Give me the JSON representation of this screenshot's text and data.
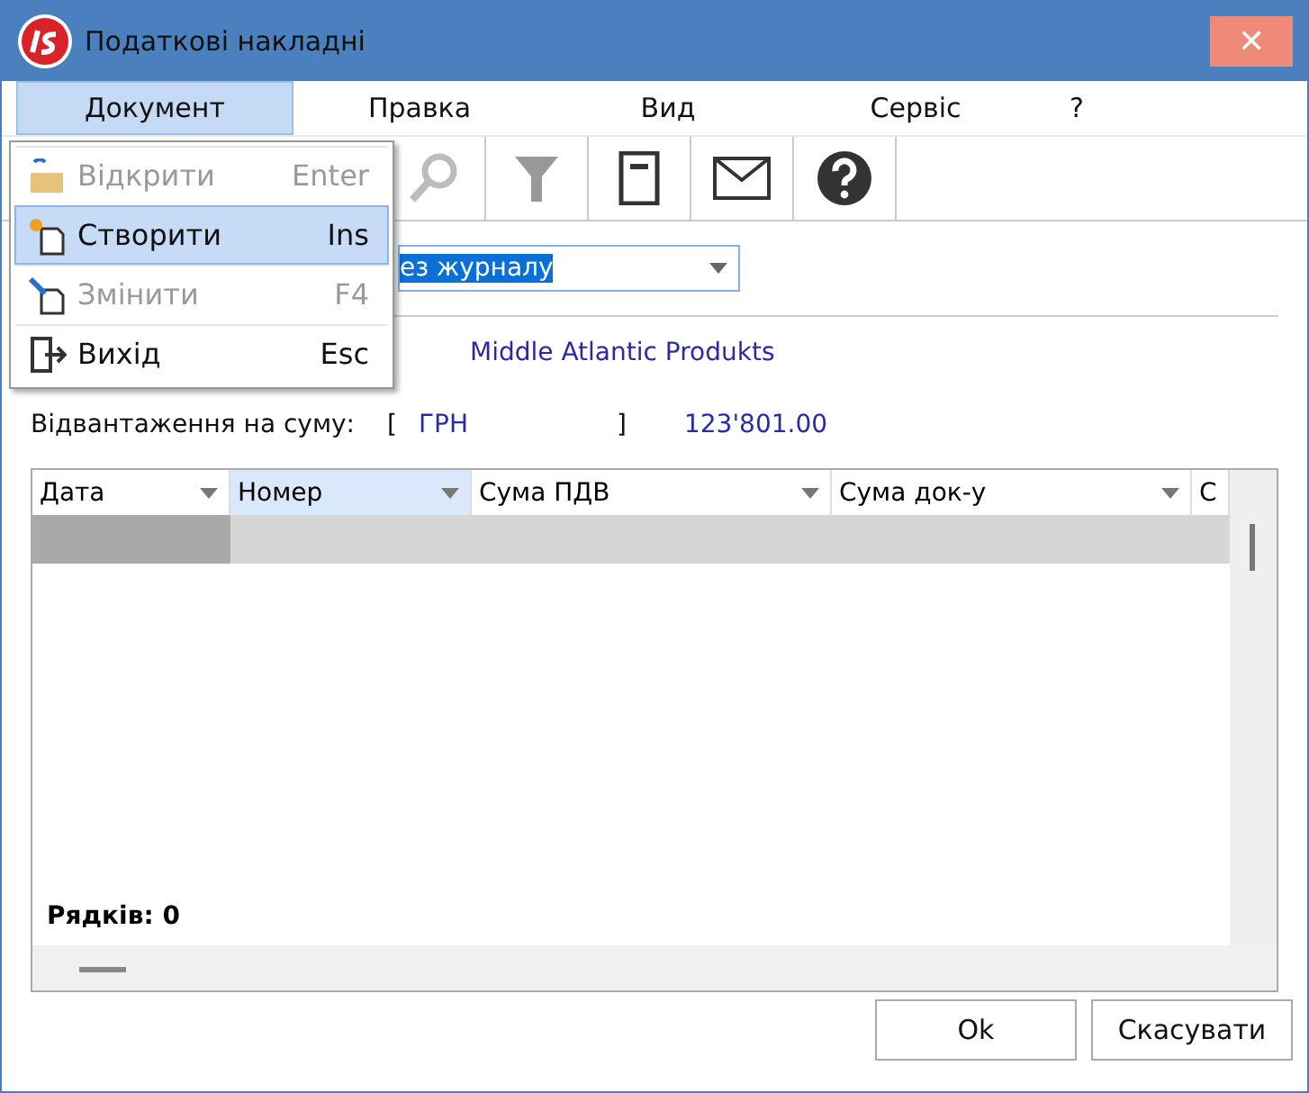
{
  "window": {
    "title": "Податкові накладні",
    "close": "✕"
  },
  "menu": [
    {
      "label": "Документ",
      "selected": true
    },
    {
      "label": "Правка",
      "selected": false
    },
    {
      "label": "Вид",
      "selected": false
    },
    {
      "label": "Сервіс",
      "selected": false
    },
    {
      "label": "?",
      "selected": false
    }
  ],
  "dropdown": [
    {
      "kind": "open",
      "label": "Відкрити",
      "shortcut": "Enter",
      "disabled": true,
      "selected": false
    },
    {
      "kind": "create",
      "label": "Створити",
      "shortcut": "Ins",
      "disabled": false,
      "selected": true
    },
    {
      "kind": "edit",
      "label": "Змінити",
      "shortcut": "F4",
      "disabled": true,
      "selected": false
    },
    {
      "kind": "exit",
      "label": "Вихід",
      "shortcut": "Esc",
      "disabled": false,
      "selected": false
    }
  ],
  "toolbar": [
    {
      "kind": "search"
    },
    {
      "kind": "filter"
    },
    {
      "kind": "notebook"
    },
    {
      "kind": "mail"
    },
    {
      "kind": "help"
    }
  ],
  "journal": {
    "value": "ез журналу"
  },
  "counterparty": {
    "name": "Middle Atlantic Produkts"
  },
  "shipment": {
    "label": "Відвантаження на суму:",
    "open": "[",
    "currency": "ГРН",
    "close": "]",
    "amount": "123'801.00"
  },
  "table": {
    "columns": [
      {
        "label": "Дата",
        "selected": false
      },
      {
        "label": "Номер",
        "selected": true
      },
      {
        "label": "Сума ПДВ",
        "selected": false
      },
      {
        "label": "Сума  док-у",
        "selected": false
      },
      {
        "label": "С",
        "selected": false
      }
    ],
    "footer": "Рядків: 0"
  },
  "buttons": [
    "Ok",
    "Скасувати"
  ]
}
